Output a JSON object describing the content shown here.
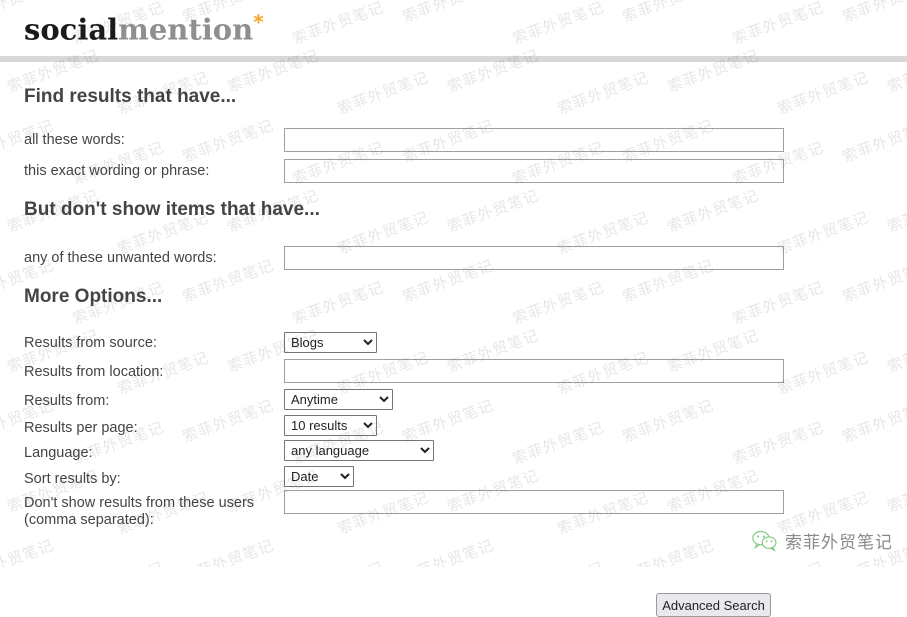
{
  "site": {
    "logo_part1": "social",
    "logo_part2": "mention",
    "logo_star": "*",
    "accent_color": "#f5a623",
    "logo_dark_color": "#1a1a1a",
    "logo_gray_color": "#8f8f8f"
  },
  "sections": {
    "find": "Find results that have...",
    "exclude": "But don't show items that have...",
    "more": "More Options..."
  },
  "fields": {
    "all_words": {
      "label": "all these words:",
      "value": "",
      "placeholder": ""
    },
    "exact_phrase": {
      "label": "this exact wording or phrase:",
      "value": "",
      "placeholder": ""
    },
    "unwanted_words": {
      "label": "any of these unwanted words:",
      "value": "",
      "placeholder": ""
    },
    "source": {
      "label": "Results from source:",
      "value": "Blogs",
      "options": [
        "Blogs"
      ]
    },
    "location": {
      "label": "Results from location:",
      "value": "",
      "placeholder": ""
    },
    "date_from": {
      "label": "Results from:",
      "value": "Anytime",
      "options": [
        "Anytime"
      ]
    },
    "per_page": {
      "label": "Results per page:",
      "value": "10 results",
      "options": [
        "10 results"
      ]
    },
    "language": {
      "label": "Language:",
      "value": "any language",
      "options": [
        "any language"
      ]
    },
    "sort_by": {
      "label": "Sort results by:",
      "value": "Date",
      "options": [
        "Date"
      ]
    },
    "blocked_users": {
      "label_line1": "Don't show results from these users",
      "label_line2": "(comma separated):",
      "value": "",
      "placeholder": ""
    }
  },
  "actions": {
    "submit_label": "Advanced Search"
  },
  "badge": {
    "icon": "wechat-icon",
    "text": "索菲外贸笔记",
    "icon_color": "#7ec67e",
    "text_color": "#8a8a8a"
  },
  "watermark": {
    "text": "索菲外贸笔记"
  }
}
